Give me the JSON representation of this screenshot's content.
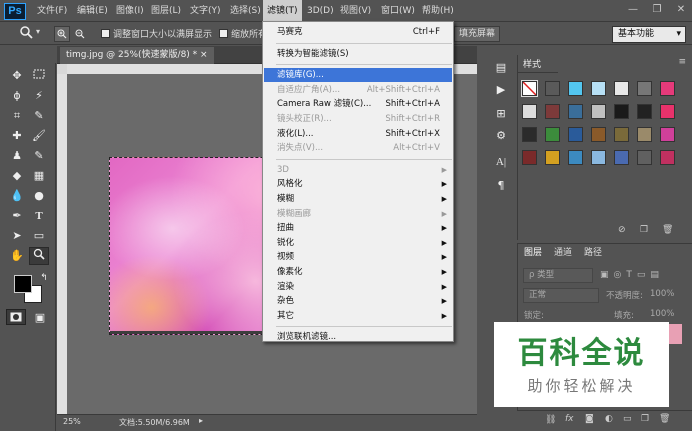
{
  "app": {
    "logo": "Ps"
  },
  "menubar": {
    "items": [
      "文件(F)",
      "编辑(E)",
      "图像(I)",
      "图层(L)",
      "文字(Y)",
      "选择(S)",
      "滤镜(T)",
      "3D(D)",
      "视图(V)",
      "窗口(W)",
      "帮助(H)"
    ],
    "active_index": 6
  },
  "window_controls": {
    "minimize": "—",
    "restore": "❐",
    "close": "✕"
  },
  "options_bar": {
    "tool_icon": "zoom-icon",
    "resize_windows_label": "调整窗口大小以满屏显示",
    "zoom_all_windows_label": "缩放所有",
    "fill_screen_button": "填充屏幕",
    "workspace": "基本功能"
  },
  "document": {
    "tab_title": "timg.jpg @ 25%(快速蒙版/8) *",
    "tab_close": "×",
    "zoom": "25%",
    "doc_size": "文档:5.50M/6.96M"
  },
  "filter_menu": {
    "items": [
      {
        "label": "马赛克",
        "shortcut": "Ctrl+F",
        "disabled": false,
        "submenu": false,
        "highlight": false
      },
      {
        "sep": true
      },
      {
        "label": "转换为智能滤镜(S)",
        "shortcut": "",
        "disabled": false,
        "submenu": false,
        "highlight": false
      },
      {
        "sep": true
      },
      {
        "label": "滤镜库(G)...",
        "shortcut": "",
        "disabled": false,
        "submenu": false,
        "highlight": true
      },
      {
        "label": "自适应广角(A)...",
        "shortcut": "Alt+Shift+Ctrl+A",
        "disabled": true,
        "submenu": false,
        "highlight": false
      },
      {
        "label": "Camera Raw 滤镜(C)...",
        "shortcut": "Shift+Ctrl+A",
        "disabled": false,
        "submenu": false,
        "highlight": false
      },
      {
        "label": "镜头校正(R)...",
        "shortcut": "Shift+Ctrl+R",
        "disabled": true,
        "submenu": false,
        "highlight": false
      },
      {
        "label": "液化(L)...",
        "shortcut": "Shift+Ctrl+X",
        "disabled": false,
        "submenu": false,
        "highlight": false
      },
      {
        "label": "消失点(V)...",
        "shortcut": "Alt+Ctrl+V",
        "disabled": true,
        "submenu": false,
        "highlight": false
      },
      {
        "sep": true
      },
      {
        "label": "3D",
        "shortcut": "",
        "disabled": true,
        "submenu": true,
        "highlight": false
      },
      {
        "label": "风格化",
        "shortcut": "",
        "disabled": false,
        "submenu": true,
        "highlight": false
      },
      {
        "label": "模糊",
        "shortcut": "",
        "disabled": false,
        "submenu": true,
        "highlight": false
      },
      {
        "label": "模糊画廊",
        "shortcut": "",
        "disabled": true,
        "submenu": true,
        "highlight": false
      },
      {
        "label": "扭曲",
        "shortcut": "",
        "disabled": false,
        "submenu": true,
        "highlight": false
      },
      {
        "label": "锐化",
        "shortcut": "",
        "disabled": false,
        "submenu": true,
        "highlight": false
      },
      {
        "label": "视频",
        "shortcut": "",
        "disabled": false,
        "submenu": true,
        "highlight": false
      },
      {
        "label": "像素化",
        "shortcut": "",
        "disabled": false,
        "submenu": true,
        "highlight": false
      },
      {
        "label": "渲染",
        "shortcut": "",
        "disabled": false,
        "submenu": true,
        "highlight": false
      },
      {
        "label": "杂色",
        "shortcut": "",
        "disabled": false,
        "submenu": true,
        "highlight": false
      },
      {
        "label": "其它",
        "shortcut": "",
        "disabled": false,
        "submenu": true,
        "highlight": false
      },
      {
        "sep": true
      },
      {
        "label": "浏览联机滤镜...",
        "shortcut": "",
        "disabled": false,
        "submenu": false,
        "highlight": false
      }
    ]
  },
  "styles_panel": {
    "tab": "样式",
    "swatch_colors": [
      "#ffffff",
      "#5a5a5a",
      "#53c6f0",
      "#b7e0f5",
      "#e8e8e8",
      "#777777",
      "#e63a7a",
      "#dddddd",
      "#7d3a3a",
      "#3a6e9a",
      "#c0c0c0",
      "#1a1a1a",
      "#222",
      "#e8326b",
      "#2b2b2b",
      "#3c8c3c",
      "#2a5b9a",
      "#8a5a2a",
      "#7a6a3a",
      "#9a8a6a",
      "#d0409a",
      "#7a2a2a",
      "#d4a020",
      "#3c8ac0",
      "#8ab8e0",
      "#4a6ab0",
      "#606060",
      "#c03060"
    ]
  },
  "layers_panel": {
    "tabs": [
      "图层",
      "通道",
      "路径"
    ],
    "kind_label": "ρ 类型",
    "blend_mode": "正常",
    "opacity_label": "不透明度:",
    "opacity_value": "100%",
    "lock_label": "锁定:",
    "fill_label": "填充:",
    "fill_value": "100%"
  },
  "watermark": {
    "title": "百科全说",
    "subtitle": "助你轻松解决"
  }
}
